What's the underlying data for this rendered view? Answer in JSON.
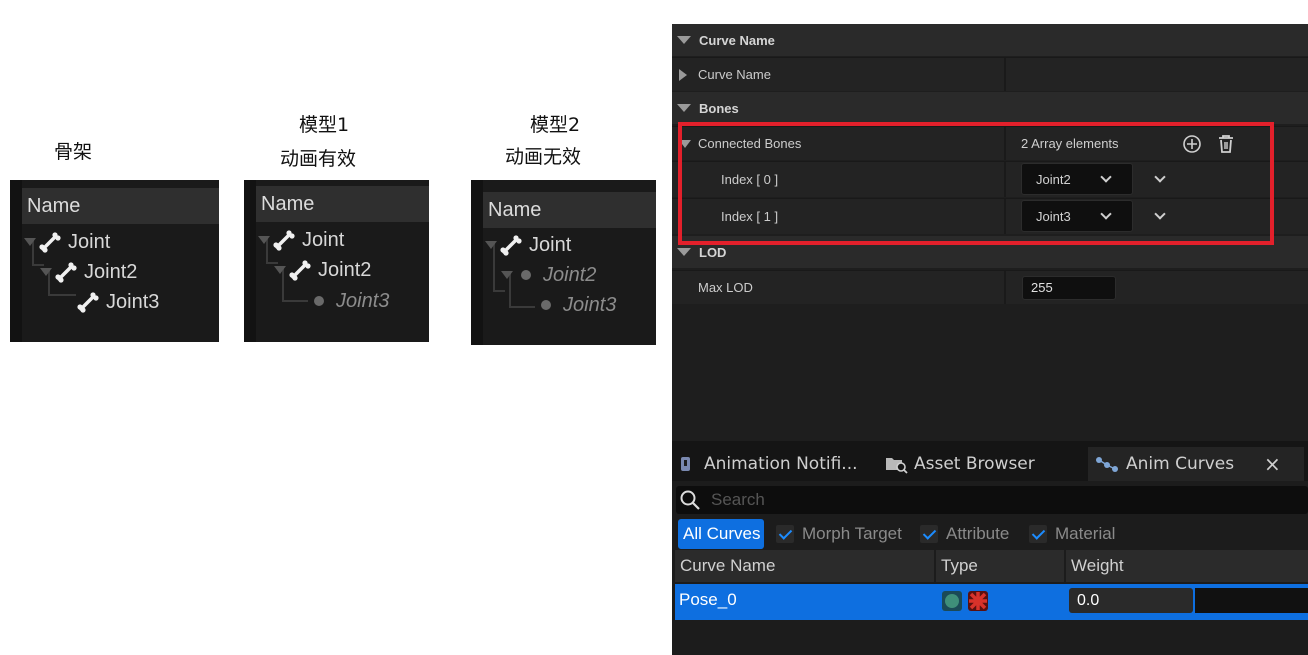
{
  "captions": {
    "skeleton": "骨架",
    "model1_title": "模型1",
    "model1_sub": "动画有效",
    "model2_title": "模型2",
    "model2_sub": "动画无效"
  },
  "trees": {
    "header": "Name",
    "skeleton": [
      "Joint",
      "Joint2",
      "Joint3"
    ],
    "model1": [
      "Joint",
      "Joint2",
      "Joint3"
    ],
    "model2": [
      "Joint",
      "Joint2",
      "Joint3"
    ]
  },
  "details": {
    "section_curve_name": "Curve Name",
    "row_curve_name": "Curve Name",
    "section_bones": "Bones",
    "connected_bones_label": "Connected Bones",
    "array_count": "2 Array elements",
    "index0_label": "Index [ 0 ]",
    "index0_value": "Joint2",
    "index1_label": "Index [ 1 ]",
    "index1_value": "Joint3",
    "section_lod": "LOD",
    "max_lod_label": "Max LOD",
    "max_lod_value": "255"
  },
  "tabs": {
    "notifies": "Animation Notifi...",
    "asset_browser": "Asset Browser",
    "anim_curves": "Anim Curves",
    "close": "×"
  },
  "curves": {
    "search_placeholder": "Search",
    "filter_all": "All Curves",
    "filter_morph": "Morph Target",
    "filter_attribute": "Attribute",
    "filter_material": "Material",
    "col_name": "Curve Name",
    "col_type": "Type",
    "col_weight": "Weight",
    "row_name": "Pose_0",
    "row_weight": "0.0"
  },
  "colors": {
    "highlight_box": "#e3202b",
    "selection": "#0e6fe0",
    "accent": "#1c8cff"
  }
}
